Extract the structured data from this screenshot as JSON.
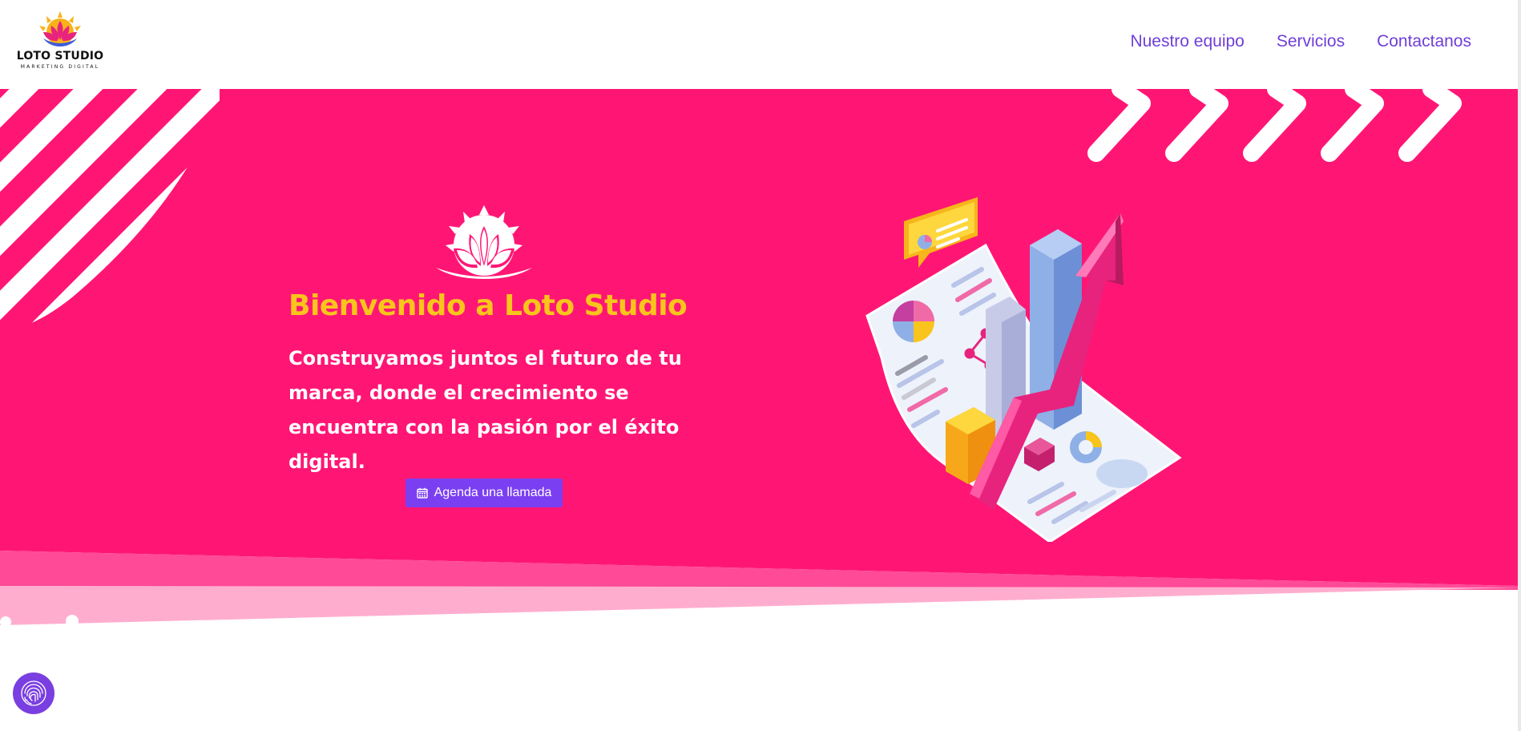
{
  "brand": {
    "name": "LOTO STUDIO",
    "tagline": "MARKETING DIGITAL"
  },
  "nav": {
    "items": [
      {
        "label": "Nuestro equipo"
      },
      {
        "label": "Servicios"
      },
      {
        "label": "Contactanos"
      }
    ]
  },
  "hero": {
    "title": "Bienvenido a Loto Studio",
    "description": "Construyamos juntos el futuro de tu marca, donde el crecimiento se encuentra con la pasión por el éxito digital.",
    "cta_label": "Agenda una llamada",
    "cta_icon": "calendar-icon"
  },
  "colors": {
    "hero_pink": "#ff1675",
    "accent_yellow": "#f9c51c",
    "accent_purple": "#7b3ff2",
    "nav_purple": "#6f3fd8"
  },
  "icons": {
    "logo": "lotus-sun-logo",
    "hero_logo": "lotus-icon",
    "cookie": "fingerprint-cookie-icon",
    "illustration": "analytics-report-illustration"
  }
}
